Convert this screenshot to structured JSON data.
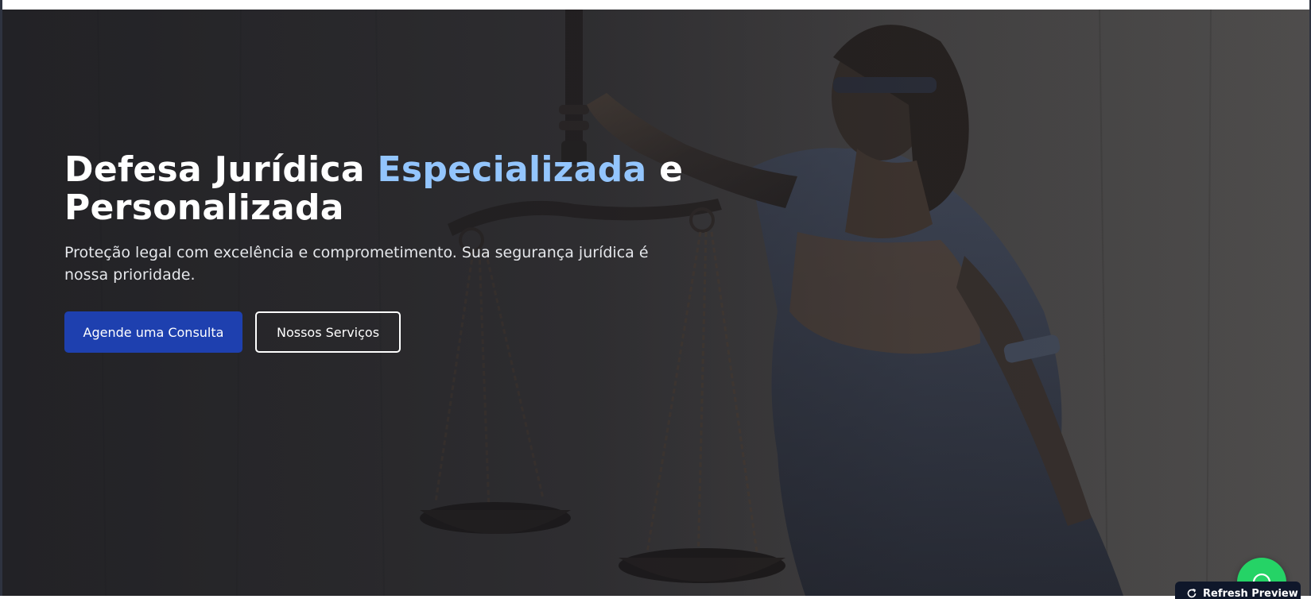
{
  "hero": {
    "title_part1": "Defesa Jurídica ",
    "title_accent": "Especializada",
    "title_part2": " e Personalizada",
    "subtitle": "Proteção legal com excelência e comprometimento. Sua segurança jurídica é nossa prioridade.",
    "primary_button": "Agende uma Consulta",
    "secondary_button": "Nossos Serviços",
    "background_image": "lady-justice-statue-with-scales"
  },
  "floating": {
    "whatsapp_icon": "whatsapp-icon",
    "refresh_label": "Refresh Preview",
    "refresh_icon": "refresh-icon"
  },
  "colors": {
    "accent_text": "#93c5fd",
    "primary_button": "#1e40af",
    "whatsapp": "#25d366",
    "refresh_bg": "#0f172a"
  }
}
